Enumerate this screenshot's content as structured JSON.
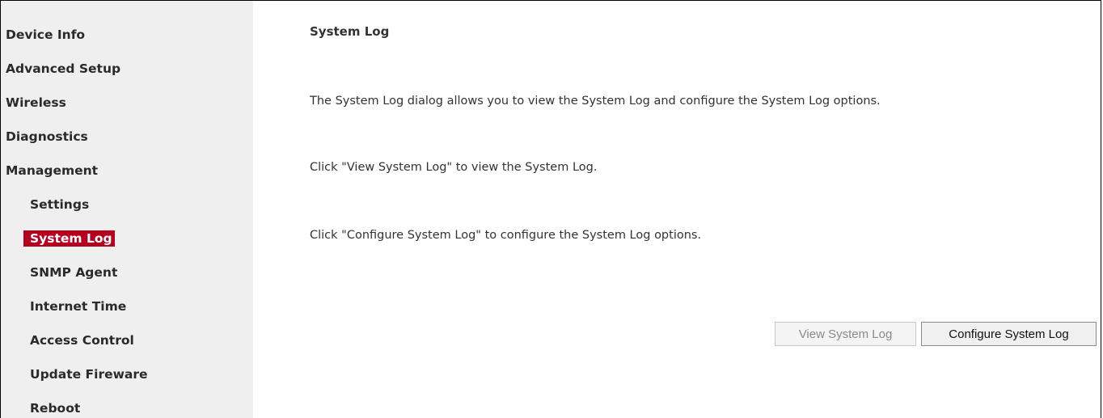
{
  "sidebar": {
    "items": [
      {
        "label": "Device Info"
      },
      {
        "label": "Advanced Setup"
      },
      {
        "label": "Wireless"
      },
      {
        "label": "Diagnostics"
      },
      {
        "label": "Management"
      },
      {
        "label": "Settings"
      },
      {
        "label": "System Log",
        "active": true
      },
      {
        "label": "SNMP Agent"
      },
      {
        "label": "Internet Time"
      },
      {
        "label": "Access Control"
      },
      {
        "label": "Update Fireware"
      },
      {
        "label": "Reboot"
      }
    ]
  },
  "main": {
    "title": "System Log",
    "description": "The System Log dialog allows you to view the System Log and configure the System Log options.",
    "view_instruction": "Click \"View System Log\" to view the System Log.",
    "configure_instruction": "Click \"Configure System Log\" to configure the System Log options.",
    "view_button": "View System Log",
    "configure_button": "Configure System Log"
  },
  "colors": {
    "sidebar_bg": "#efefef",
    "active_item_bg": "#b4001e"
  }
}
